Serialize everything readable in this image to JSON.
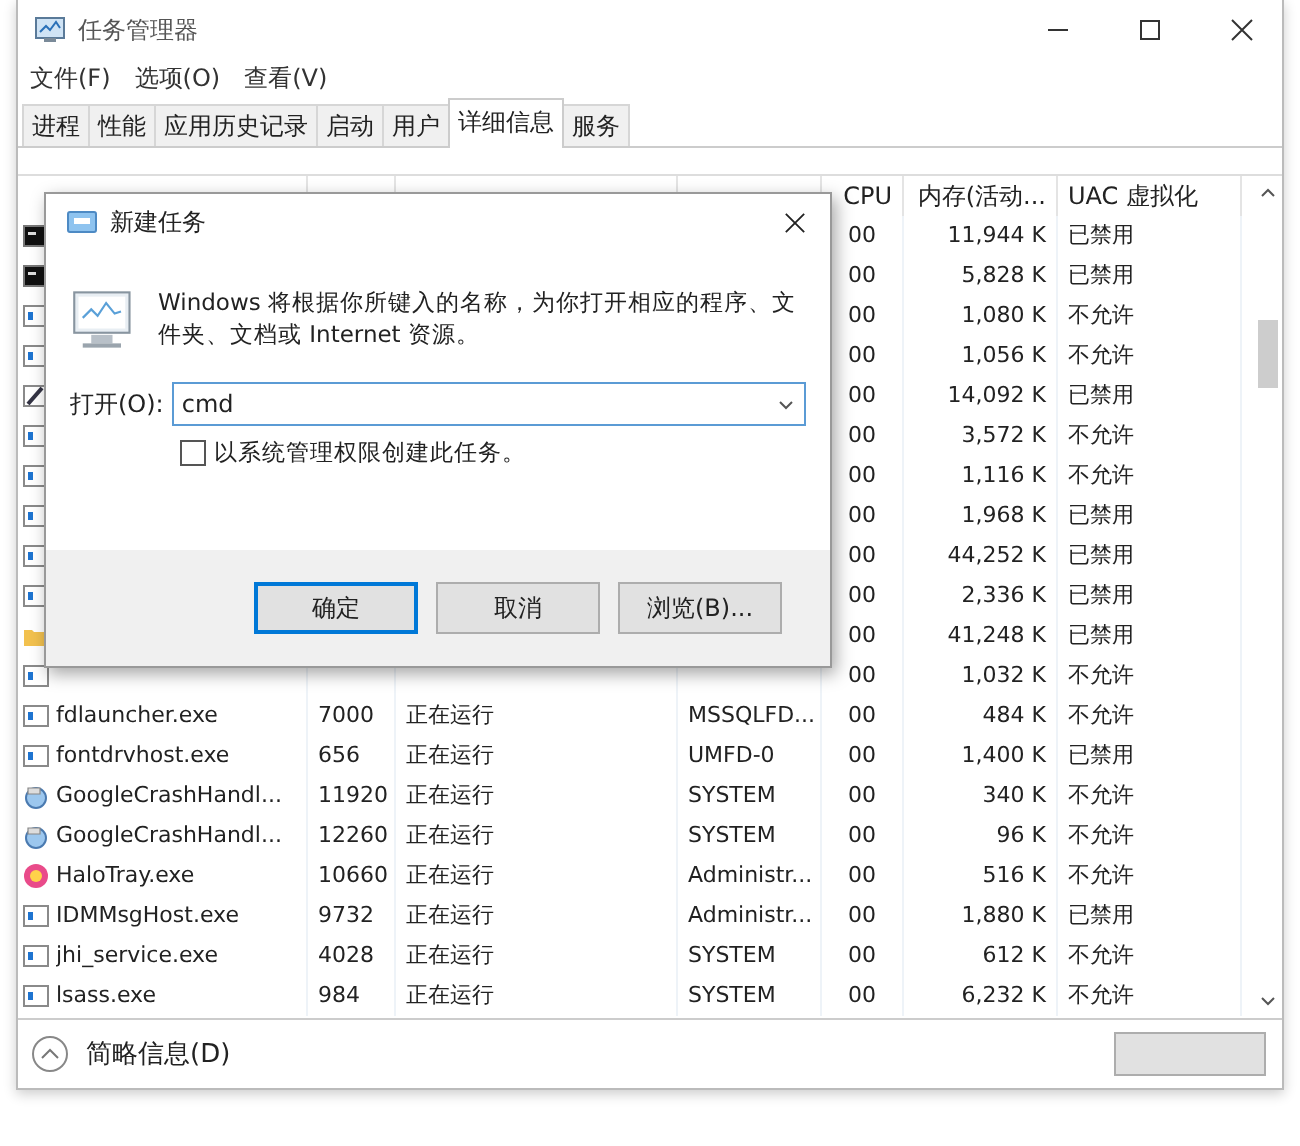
{
  "window": {
    "title": "任务管理器"
  },
  "menu": [
    "文件(F)",
    "选项(O)",
    "查看(V)"
  ],
  "tabs": [
    {
      "label": "进程",
      "selected": false
    },
    {
      "label": "性能",
      "selected": false
    },
    {
      "label": "应用历史记录",
      "selected": false
    },
    {
      "label": "启动",
      "selected": false
    },
    {
      "label": "用户",
      "selected": false
    },
    {
      "label": "详细信息",
      "selected": true
    },
    {
      "label": "服务",
      "selected": false
    }
  ],
  "table": {
    "columns": [
      "CPU",
      "内存(活动...",
      "UAC 虚拟化"
    ],
    "rows": [
      {
        "kind": "console",
        "cpu": "00",
        "memory": "11,944 K",
        "uac": "已禁用"
      },
      {
        "kind": "console",
        "cpu": "00",
        "memory": "5,828 K",
        "uac": "已禁用"
      },
      {
        "kind": "app",
        "cpu": "00",
        "memory": "1,080 K",
        "uac": "不允许"
      },
      {
        "kind": "app",
        "cpu": "00",
        "memory": "1,056 K",
        "uac": "不允许"
      },
      {
        "kind": "editor",
        "cpu": "00",
        "memory": "14,092 K",
        "uac": "已禁用"
      },
      {
        "kind": "app",
        "cpu": "00",
        "memory": "3,572 K",
        "uac": "不允许"
      },
      {
        "kind": "app",
        "cpu": "00",
        "memory": "1,116 K",
        "uac": "不允许"
      },
      {
        "kind": "app",
        "cpu": "00",
        "memory": "1,968 K",
        "uac": "已禁用"
      },
      {
        "kind": "app",
        "cpu": "00",
        "memory": "44,252 K",
        "uac": "已禁用"
      },
      {
        "kind": "app",
        "cpu": "00",
        "memory": "2,336 K",
        "uac": "已禁用"
      },
      {
        "kind": "folder",
        "cpu": "00",
        "memory": "41,248 K",
        "uac": "已禁用"
      },
      {
        "kind": "app",
        "cpu": "00",
        "memory": "1,032 K",
        "uac": "不允许"
      },
      {
        "kind": "app",
        "name": "fdlauncher.exe",
        "pid": "7000",
        "status": "正在运行",
        "user": "MSSQLFD...",
        "cpu": "00",
        "memory": "484 K",
        "uac": "不允许"
      },
      {
        "kind": "app",
        "name": "fontdrvhost.exe",
        "pid": "656",
        "status": "正在运行",
        "user": "UMFD-0",
        "cpu": "00",
        "memory": "1,400 K",
        "uac": "已禁用"
      },
      {
        "kind": "crash",
        "name": "GoogleCrashHandl...",
        "pid": "11920",
        "status": "正在运行",
        "user": "SYSTEM",
        "cpu": "00",
        "memory": "340 K",
        "uac": "不允许"
      },
      {
        "kind": "crash",
        "name": "GoogleCrashHandl...",
        "pid": "12260",
        "status": "正在运行",
        "user": "SYSTEM",
        "cpu": "00",
        "memory": "96 K",
        "uac": "不允许"
      },
      {
        "kind": "halo",
        "name": "HaloTray.exe",
        "pid": "10660",
        "status": "正在运行",
        "user": "Administr...",
        "cpu": "00",
        "memory": "516 K",
        "uac": "不允许"
      },
      {
        "kind": "app",
        "name": "IDMMsgHost.exe",
        "pid": "9732",
        "status": "正在运行",
        "user": "Administr...",
        "cpu": "00",
        "memory": "1,880 K",
        "uac": "已禁用"
      },
      {
        "kind": "app",
        "name": "jhi_service.exe",
        "pid": "4028",
        "status": "正在运行",
        "user": "SYSTEM",
        "cpu": "00",
        "memory": "612 K",
        "uac": "不允许"
      },
      {
        "kind": "app",
        "name": "lsass.exe",
        "pid": "984",
        "status": "正在运行",
        "user": "SYSTEM",
        "cpu": "00",
        "memory": "6,232 K",
        "uac": "不允许"
      }
    ]
  },
  "footer": {
    "label": "简略信息(D)"
  },
  "dialog": {
    "title": "新建任务",
    "message": "Windows 将根据你所键入的名称，为你打开相应的程序、文件夹、文档或 Internet 资源。",
    "open_label": "打开(O):",
    "open_value": "cmd",
    "checkbox": {
      "label": "以系统管理权限创建此任务。",
      "checked": false
    },
    "buttons": [
      {
        "label": "确定",
        "selected": true
      },
      {
        "label": "取消",
        "selected": false
      },
      {
        "label": "浏览(B)...",
        "selected": false
      }
    ]
  }
}
